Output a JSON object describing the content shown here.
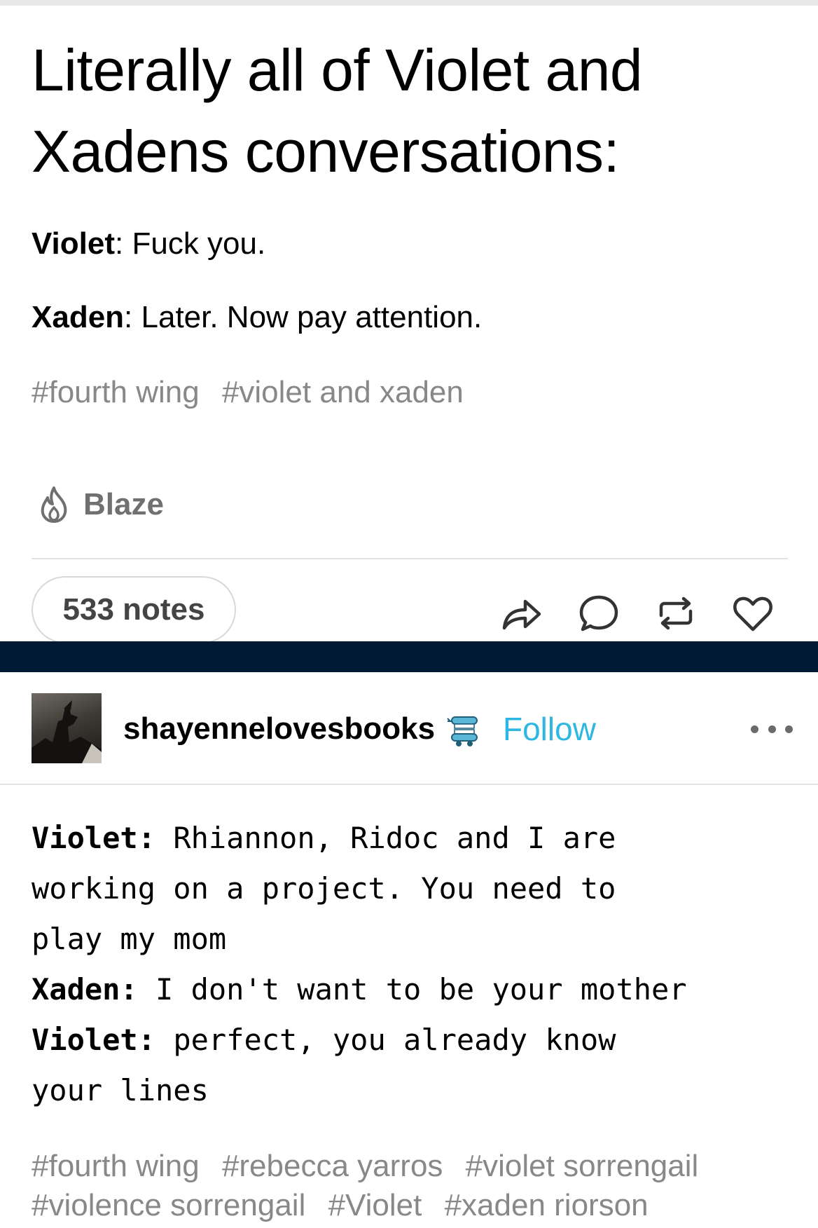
{
  "post1": {
    "title": "Literally all of Violet and Xadens conversations:",
    "lines": [
      {
        "speaker": "Violet",
        "sep": ": ",
        "text": "Fuck you."
      },
      {
        "speaker": "Xaden",
        "sep": ": ",
        "text": "Later. Now pay attention."
      }
    ],
    "tags": [
      "#fourth wing",
      "#violet and xaden"
    ],
    "blaze_label": "Blaze",
    "notes_label": "533 notes",
    "actions": [
      "share-icon",
      "reply-icon",
      "reblog-icon",
      "like-icon"
    ]
  },
  "post2": {
    "username": "shayennelovesbooks",
    "follow_label": "Follow",
    "accent_color": "#2fb7e4",
    "dialogue": [
      {
        "speaker": "Violet:",
        "text_lines": [
          "Rhiannon, Ridoc and I are",
          "working on a project. You need to",
          "play my mom"
        ]
      },
      {
        "speaker": "Xaden:",
        "text_lines": [
          "I don't want to be your mother"
        ]
      },
      {
        "speaker": "Violet:",
        "text_lines": [
          "perfect, you already know",
          "your lines"
        ]
      }
    ],
    "tags_row1": [
      "#fourth wing",
      "#rebecca yarros",
      "#violet sorrengail"
    ],
    "tags_row2": [
      "#violence sorrengail",
      "#Violet",
      "#xaden riorson"
    ]
  },
  "colors": {
    "divider_bar": "#001935",
    "tag_gray": "#888888"
  }
}
